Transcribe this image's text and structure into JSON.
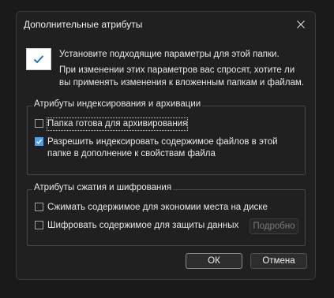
{
  "dialog": {
    "title": "Дополнительные атрибуты",
    "intro_main": "Установите подходящие параметры для этой папки.",
    "intro_sub": "При изменении этих параметров вас спросят, хотите ли вы применять изменения к вложенным папкам и файлам."
  },
  "indexing_group": {
    "legend": "Атрибуты индексирования и архивации",
    "archive": {
      "label": "Папка готова для архивирования",
      "checked": false
    },
    "index": {
      "label": "Разрешить индексировать содержимое файлов в этой папке в дополнение к свойствам файла",
      "checked": true
    }
  },
  "compress_group": {
    "legend": "Атрибуты сжатия и шифрования",
    "compress": {
      "label": "Сжимать содержимое для экономии места на диске",
      "checked": false
    },
    "encrypt": {
      "label": "Шифровать содержимое для защиты данных",
      "checked": false
    },
    "details_button": "Подробно"
  },
  "buttons": {
    "ok": "ОК",
    "cancel": "Отмена"
  },
  "colors": {
    "accent": "#4aa3f0",
    "background": "#202020"
  },
  "icons": {
    "close": "close-icon",
    "big_check": "checkmark-icon"
  }
}
